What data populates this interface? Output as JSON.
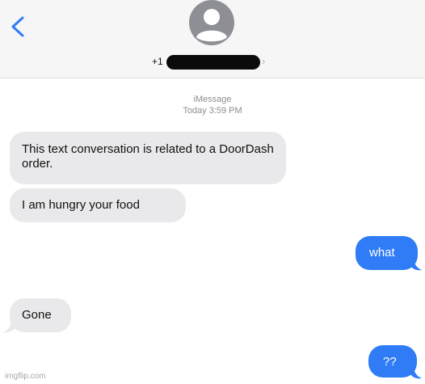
{
  "header": {
    "back_icon": "chevron-left-icon",
    "avatar_icon": "person-icon",
    "contact_prefix": "+1",
    "accent": "#2f7cf6"
  },
  "meta": {
    "service": "iMessage",
    "timestamp": "Today 3:59 PM"
  },
  "messages": [
    {
      "side": "received",
      "text": "This text conversation is related to a DoorDash order."
    },
    {
      "side": "received",
      "text": "I am hungry your food"
    },
    {
      "side": "sent",
      "text": "what"
    },
    {
      "side": "received",
      "text": "Gone"
    },
    {
      "side": "sent",
      "text": "??"
    }
  ],
  "watermark": "imgflip.com"
}
